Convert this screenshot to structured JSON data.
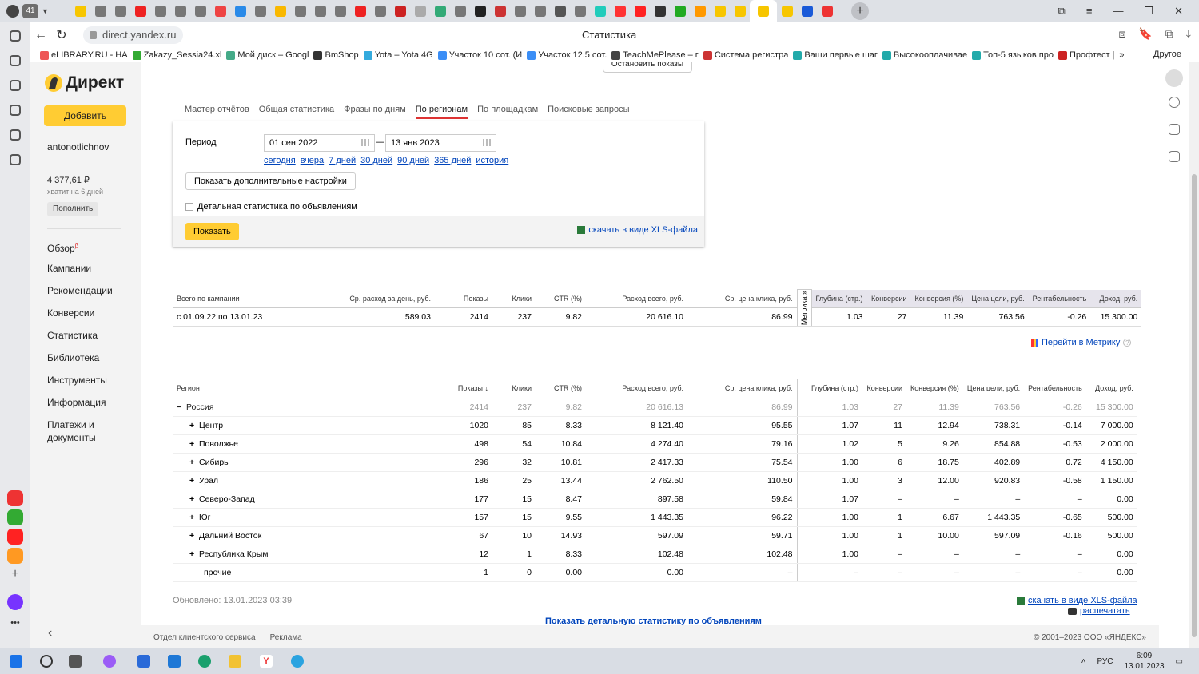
{
  "browser": {
    "tab_count": "41",
    "url": "direct.yandex.ru",
    "page_title": "Статистика",
    "bookmarks": [
      "eLIBRARY.RU - НА",
      "Zakazy_Sessia24.xl",
      "Мой диск – Googl",
      "BmShop",
      "Yota – Yota 4G",
      "Участок 10 сот. (И",
      "Участок 12.5 сот.",
      "TeachMePlease – г",
      "Система регистра",
      "Ваши первые шаг",
      "Высокооплачивае",
      "Топ-5 языков про",
      "Профтест |"
    ],
    "bookmarks_more": "»",
    "bookmarks_other": "Другое"
  },
  "direct": {
    "logo": "Директ",
    "add_button": "Добавить",
    "login": "antonotlichnov",
    "balance": "4 377,61 ₽",
    "balance_note": "хватит на 6 дней",
    "topup": "Пополнить",
    "menu": [
      {
        "label": "Обзор",
        "badge": "β"
      },
      {
        "label": "Кампании"
      },
      {
        "label": "Рекомендации"
      },
      {
        "label": "Конверсии"
      },
      {
        "label": "Статистика"
      },
      {
        "label": "Библиотека"
      },
      {
        "label": "Инструменты"
      },
      {
        "label": "Информация"
      },
      {
        "label": "Платежи и документы"
      }
    ],
    "stop_shows": "Остановить показы"
  },
  "report_tabs": [
    "Мастер отчётов",
    "Общая статистика",
    "Фразы по дням",
    "По регионам",
    "По площадкам",
    "Поисковые запросы"
  ],
  "active_tab": "По регионам",
  "filter": {
    "period_label": "Период",
    "date_from": "01 сен 2022",
    "date_to": "13 янв 2023",
    "dash": "—",
    "quick_links": [
      "сегодня",
      "вчера",
      "7 дней",
      "30 дней",
      "90 дней",
      "365 дней",
      "история"
    ],
    "more_settings": "Показать дополнительные настройки",
    "detail_checkbox": "Детальная статистика по объявлениям",
    "show_button": "Показать",
    "xls_link": "скачать в виде XLS-файла"
  },
  "summary": {
    "headers": [
      "Всего по кампании",
      "Ср. расход за день, руб.",
      "Показы",
      "Клики",
      "CTR (%)",
      "Расход всего, руб.",
      "Ср. цена клика, руб."
    ],
    "metrika_label": "Метрика »",
    "metrika_headers": [
      "Глубина (стр.)",
      "Конверсии",
      "Конверсия (%)",
      "Цена цели, руб.",
      "Рентабельность",
      "Доход, руб."
    ],
    "row": [
      "с 01.09.22 по 13.01.23",
      "589.03",
      "2414",
      "237",
      "9.82",
      "20 616.10",
      "86.99"
    ],
    "metrika_row": [
      "1.03",
      "27",
      "11.39",
      "763.56",
      "-0.26",
      "15 300.00"
    ]
  },
  "metrika_link": "Перейти в Метрику",
  "metrika_help": "?",
  "regions": {
    "headers": [
      "Регион",
      "Показы ↓",
      "Клики",
      "CTR (%)",
      "Расход всего, руб.",
      "Ср. цена клика, руб.",
      "Глубина (стр.)",
      "Конверсии",
      "Конверсия (%)",
      "Цена цели, руб.",
      "Рентабельность",
      "Доход, руб."
    ],
    "rows": [
      {
        "toggle": "−",
        "name": "Россия",
        "cells": [
          "2414",
          "237",
          "9.82",
          "20 616.13",
          "86.99",
          "1.03",
          "27",
          "11.39",
          "763.56",
          "-0.26",
          "15 300.00"
        ]
      },
      {
        "toggle": "+",
        "name": "Центр",
        "cells": [
          "1020",
          "85",
          "8.33",
          "8 121.40",
          "95.55",
          "1.07",
          "11",
          "12.94",
          "738.31",
          "-0.14",
          "7 000.00"
        ]
      },
      {
        "toggle": "+",
        "name": "Поволжье",
        "cells": [
          "498",
          "54",
          "10.84",
          "4 274.40",
          "79.16",
          "1.02",
          "5",
          "9.26",
          "854.88",
          "-0.53",
          "2 000.00"
        ]
      },
      {
        "toggle": "+",
        "name": "Сибирь",
        "cells": [
          "296",
          "32",
          "10.81",
          "2 417.33",
          "75.54",
          "1.00",
          "6",
          "18.75",
          "402.89",
          "0.72",
          "4 150.00"
        ]
      },
      {
        "toggle": "+",
        "name": "Урал",
        "cells": [
          "186",
          "25",
          "13.44",
          "2 762.50",
          "110.50",
          "1.00",
          "3",
          "12.00",
          "920.83",
          "-0.58",
          "1 150.00"
        ]
      },
      {
        "toggle": "+",
        "name": "Северо-Запад",
        "cells": [
          "177",
          "15",
          "8.47",
          "897.58",
          "59.84",
          "1.07",
          "–",
          "–",
          "–",
          "–",
          "0.00"
        ]
      },
      {
        "toggle": "+",
        "name": "Юг",
        "cells": [
          "157",
          "15",
          "9.55",
          "1 443.35",
          "96.22",
          "1.00",
          "1",
          "6.67",
          "1 443.35",
          "-0.65",
          "500.00"
        ]
      },
      {
        "toggle": "+",
        "name": "Дальний Восток",
        "cells": [
          "67",
          "10",
          "14.93",
          "597.09",
          "59.71",
          "1.00",
          "1",
          "10.00",
          "597.09",
          "-0.16",
          "500.00"
        ]
      },
      {
        "toggle": "+",
        "name": "Республика Крым",
        "cells": [
          "12",
          "1",
          "8.33",
          "102.48",
          "102.48",
          "1.00",
          "–",
          "–",
          "–",
          "–",
          "0.00"
        ]
      },
      {
        "toggle": "",
        "name": "прочие",
        "cells": [
          "1",
          "0",
          "0.00",
          "0.00",
          "–",
          "–",
          "–",
          "–",
          "–",
          "–",
          "0.00"
        ]
      }
    ]
  },
  "updated": "Обновлено: 13.01.2023 03:39",
  "xls_link_bottom": "скачать в виде XLS-файла",
  "print_link": "распечатать",
  "show_detail_link": "Показать детальную статистику по объявлениям",
  "footer": {
    "links": [
      "Отдел клиентского сервиса",
      "Реклама"
    ],
    "copyright": "© 2001–2023 ООО «ЯНДЕКС»"
  },
  "taskbar": {
    "lang": "РУС",
    "time": "6:09",
    "date": "13.01.2023"
  }
}
